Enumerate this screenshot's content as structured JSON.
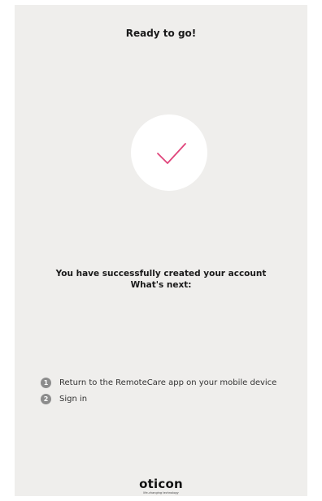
{
  "screen": {
    "title": "Ready to go!",
    "success_icon": "checkmark-icon",
    "accent_color": "#e0457b"
  },
  "message": {
    "line1": "You have successfully created your account",
    "line2": "What's next:"
  },
  "steps": [
    {
      "number": "1",
      "text": "Return to the RemoteCare app on your mobile device"
    },
    {
      "number": "2",
      "text": "Sign in"
    }
  ],
  "footer": {
    "brand": "oticon",
    "tagline": "life-changing technology"
  }
}
